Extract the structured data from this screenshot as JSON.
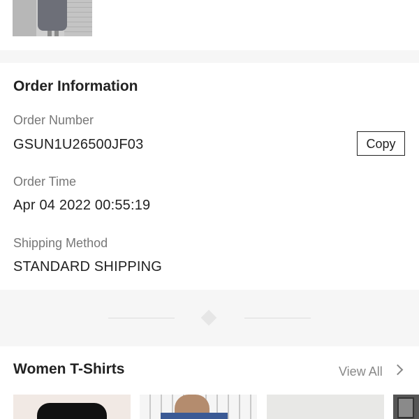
{
  "order_info": {
    "title": "Order Information",
    "order_number_label": "Order Number",
    "order_number": "GSUN1U26500JF03",
    "copy_label": "Copy",
    "order_time_label": "Order Time",
    "order_time": "Apr 04 2022 00:55:19",
    "shipping_method_label": "Shipping Method",
    "shipping_method": "STANDARD SHIPPING"
  },
  "recommendations": {
    "title": "Women T-Shirts",
    "view_all_label": "View All"
  },
  "icons": {
    "view_all_chevron": "chevron-right-icon",
    "divider": "diamond-icon"
  }
}
